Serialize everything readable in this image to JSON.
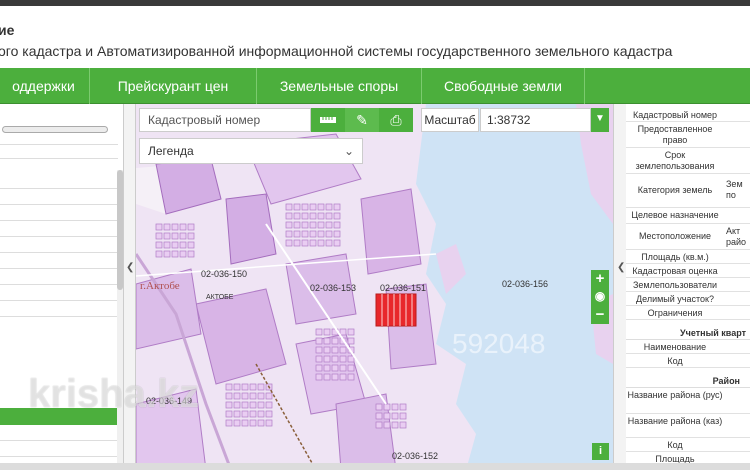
{
  "header": {
    "title_fragment": "ие",
    "subtitle": "ого кадастра и Автоматизированной информационной системы государственного земельного кадастра"
  },
  "nav": {
    "items": [
      "оддержки",
      "Прейскурант цен",
      "Земельные споры",
      "Свободные земли"
    ]
  },
  "toolbar": {
    "search_placeholder": "Кадастровый номер",
    "ruler_icon": "ruler-icon",
    "edit_icon": "pencil-icon",
    "print_icon": "printer-icon",
    "scale_label": "Масштаб",
    "scale_value": "1:38732"
  },
  "legend": {
    "label": "Легенда"
  },
  "map": {
    "labels": [
      "02-036-150",
      "АКТОБЕ",
      "г.Актобе",
      "02-036-153",
      "02-036-151",
      "02-036-156",
      "02-036-149",
      "02-036-152"
    ],
    "watermark": "krisha.kz",
    "watermark_number": "592048"
  },
  "zoom": {
    "in": "+",
    "out": "−"
  },
  "info_panel": {
    "rows": [
      {
        "key": "Кадастровый номер",
        "value": ""
      },
      {
        "key": "Предоставленное право",
        "value": ""
      },
      {
        "key": "Срок землепользования",
        "value": ""
      },
      {
        "key": "Категория земель",
        "value": "Зем\nпо"
      },
      {
        "key": "Целевое назначение",
        "value": ""
      },
      {
        "key": "Местоположение",
        "value": "Акт\nрайо"
      },
      {
        "key": "Площадь (кв.м.)",
        "value": ""
      },
      {
        "key": "Кадастровая оценка",
        "value": ""
      },
      {
        "key": "Землепользователи",
        "value": ""
      },
      {
        "key": "Делимый участок?",
        "value": ""
      },
      {
        "key": "Ограничения",
        "value": ""
      }
    ],
    "section_accounting": "Учетный кварт",
    "accounting_rows": [
      {
        "key": "Наименование",
        "value": ""
      },
      {
        "key": "Код",
        "value": ""
      }
    ],
    "section_district": "Район",
    "district_rows": [
      {
        "key": "Название района (рус)",
        "value": ""
      },
      {
        "key": "Название района (каз)",
        "value": ""
      },
      {
        "key": "Код",
        "value": ""
      },
      {
        "key": "Площадь",
        "value": ""
      }
    ]
  },
  "colors": {
    "nav_green": "#4caf3d",
    "parcel_fill": "#e3bfef",
    "parcel_stroke": "#b07cc6",
    "water": "#cfe3f5",
    "highlight": "#e8272b"
  }
}
